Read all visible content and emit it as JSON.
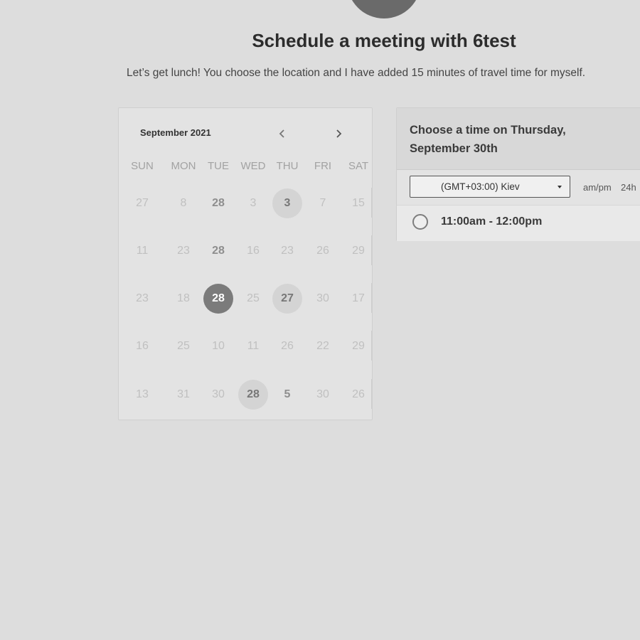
{
  "page": {
    "title": "Schedule a meeting with 6test",
    "subtitle": "Let’s get lunch! You choose the location and I have added 15 minutes of travel time for myself."
  },
  "calendar": {
    "month_label": "September 2021",
    "prev_icon": "chevron-left-icon",
    "next_icon": "chevron-right-icon",
    "weekdays": [
      "SUN",
      "MON",
      "TUE",
      "WED",
      "THU",
      "FRI",
      "SAT"
    ],
    "weeks": [
      [
        {
          "t": "27",
          "s": "muted"
        },
        {
          "t": "8",
          "s": "muted"
        },
        {
          "t": "28",
          "s": "bold"
        },
        {
          "t": "3",
          "s": "muted"
        },
        {
          "t": "3",
          "s": "available"
        },
        {
          "t": "7",
          "s": "muted"
        },
        {
          "t": "15",
          "s": "muted"
        }
      ],
      [
        {
          "t": "11",
          "s": "muted"
        },
        {
          "t": "23",
          "s": "muted"
        },
        {
          "t": "28",
          "s": "bold"
        },
        {
          "t": "16",
          "s": "muted"
        },
        {
          "t": "23",
          "s": "muted"
        },
        {
          "t": "26",
          "s": "muted"
        },
        {
          "t": "29",
          "s": "muted"
        }
      ],
      [
        {
          "t": "23",
          "s": "muted"
        },
        {
          "t": "18",
          "s": "muted"
        },
        {
          "t": "28",
          "s": "selected"
        },
        {
          "t": "25",
          "s": "muted"
        },
        {
          "t": "27",
          "s": "available"
        },
        {
          "t": "30",
          "s": "muted"
        },
        {
          "t": "17",
          "s": "muted"
        }
      ],
      [
        {
          "t": "16",
          "s": "muted"
        },
        {
          "t": "25",
          "s": "muted"
        },
        {
          "t": "10",
          "s": "muted"
        },
        {
          "t": "11",
          "s": "muted"
        },
        {
          "t": "26",
          "s": "muted"
        },
        {
          "t": "22",
          "s": "muted"
        },
        {
          "t": "29",
          "s": "muted"
        }
      ],
      [
        {
          "t": "13",
          "s": "muted"
        },
        {
          "t": "31",
          "s": "muted"
        },
        {
          "t": "30",
          "s": "muted"
        },
        {
          "t": "28",
          "s": "available"
        },
        {
          "t": "5",
          "s": "bold"
        },
        {
          "t": "30",
          "s": "muted"
        },
        {
          "t": "26",
          "s": "muted"
        }
      ]
    ]
  },
  "times": {
    "heading": "Choose a time on Thursday, September 30th",
    "timezone": "(GMT+03:00) Kiev",
    "format_ampm": "am/pm",
    "format_24h": "24h",
    "slots": [
      {
        "label": "11:00am - 12:00pm"
      }
    ]
  },
  "colors": {
    "background": "#dddddd",
    "selected_day": "#7b7b7b",
    "available_day": "#d4d4d4"
  }
}
